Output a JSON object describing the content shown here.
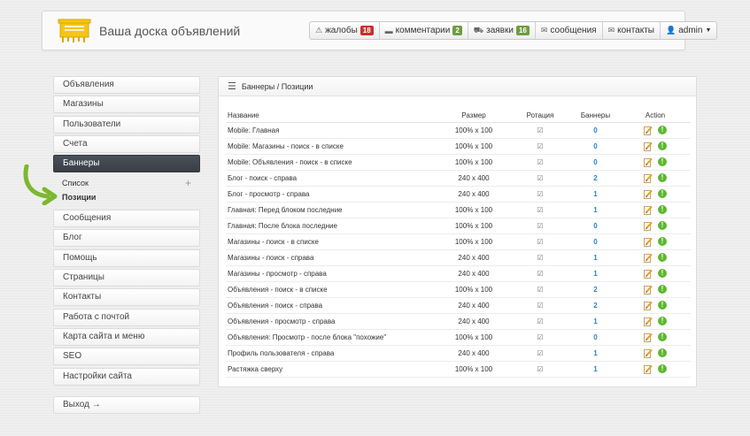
{
  "header": {
    "site_title": "Ваша доска объявлений",
    "nav": [
      {
        "label": "жалобы",
        "icon": "warning-icon",
        "badge": "18",
        "badge_color": "#c9302c"
      },
      {
        "label": "комментарии",
        "icon": "comment-icon",
        "badge": "2",
        "badge_color": "#6f9c3f"
      },
      {
        "label": "заявки",
        "icon": "cart-icon",
        "badge": "16",
        "badge_color": "#6f9c3f"
      },
      {
        "label": "сообщения",
        "icon": "mail-icon"
      },
      {
        "label": "контакты",
        "icon": "mail-icon"
      },
      {
        "label": "admin",
        "icon": "user-icon"
      }
    ]
  },
  "sidebar": {
    "items_top": [
      "Объявления",
      "Магазины",
      "Пользователи",
      "Счета",
      "Баннеры"
    ],
    "sub_items": [
      "Список",
      "Позиции"
    ],
    "items_bottom": [
      "Сообщения",
      "Блог",
      "Помощь",
      "Страницы",
      "Контакты",
      "Работа с почтой",
      "Карта сайта и меню",
      "SEO",
      "Настройки сайта"
    ],
    "logout": "Выход →"
  },
  "panel": {
    "title": "Баннеры / Позиции",
    "columns": [
      "Название",
      "Размер",
      "Ротация",
      "Баннеры",
      "Action"
    ],
    "rows": [
      {
        "name": "Mobile: Главная",
        "size": "100% x 100",
        "banners": "0"
      },
      {
        "name": "Mobile: Магазины - поиск - в списке",
        "size": "100% x 100",
        "banners": "0"
      },
      {
        "name": "Mobile: Объявления - поиск - в списке",
        "size": "100% x 100",
        "banners": "0"
      },
      {
        "name": "Блог - поиск - справа",
        "size": "240 x 400",
        "banners": "2"
      },
      {
        "name": "Блог - просмотр - справа",
        "size": "240 x 400",
        "banners": "1"
      },
      {
        "name": "Главная: Перед блоком последние",
        "size": "100% x 100",
        "banners": "1"
      },
      {
        "name": "Главная: После блока последние",
        "size": "100% x 100",
        "banners": "0"
      },
      {
        "name": "Магазины - поиск - в списке",
        "size": "100% x 100",
        "banners": "0"
      },
      {
        "name": "Магазины - поиск - справа",
        "size": "240 x 400",
        "banners": "1"
      },
      {
        "name": "Магазины - просмотр - справа",
        "size": "240 x 400",
        "banners": "1"
      },
      {
        "name": "Объявления - поиск - в списке",
        "size": "100% x 100",
        "banners": "2"
      },
      {
        "name": "Объявления - поиск - справа",
        "size": "240 x 400",
        "banners": "2"
      },
      {
        "name": "Объявления - просмотр - справа",
        "size": "240 x 400",
        "banners": "1"
      },
      {
        "name": "Объявления: Просмотр - после блока \"похожие\"",
        "size": "100% x 100",
        "banners": "0"
      },
      {
        "name": "Профиль пользователя - справа",
        "size": "240 x 400",
        "banners": "1"
      },
      {
        "name": "Растяжка сверху",
        "size": "100% x 100",
        "banners": "1"
      }
    ]
  }
}
